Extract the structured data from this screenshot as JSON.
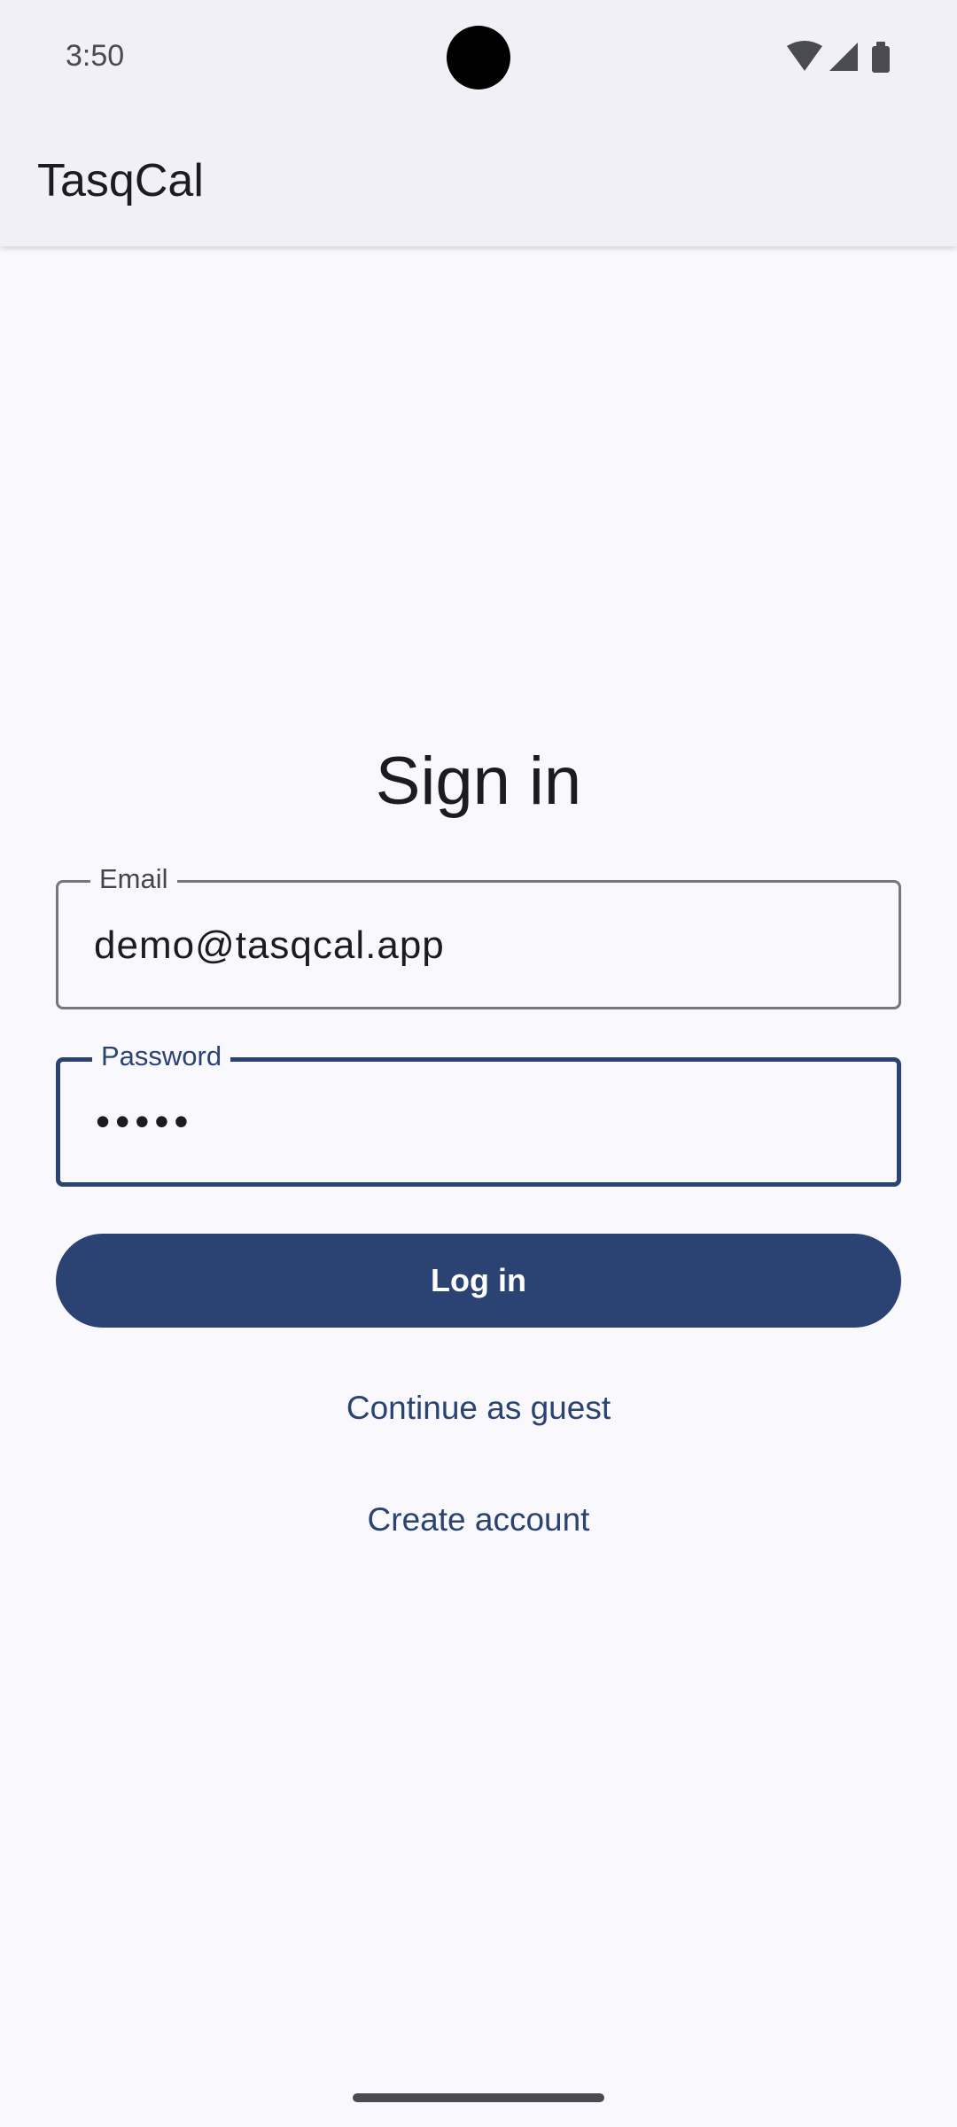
{
  "status_bar": {
    "time": "3:50",
    "icons": [
      "wifi-icon",
      "signal-icon",
      "battery-icon"
    ]
  },
  "app_bar": {
    "title": "TasqCal"
  },
  "form": {
    "heading": "Sign in",
    "email": {
      "label": "Email",
      "value": "demo@tasqcal.app"
    },
    "password": {
      "label": "Password",
      "value": "•••••"
    },
    "login_label": "Log in",
    "guest_label": "Continue as guest",
    "create_label": "Create account"
  },
  "colors": {
    "primary": "#2b4373",
    "background": "#f8f8fd",
    "surface": "#f1f0f6",
    "outline": "#76767f"
  }
}
